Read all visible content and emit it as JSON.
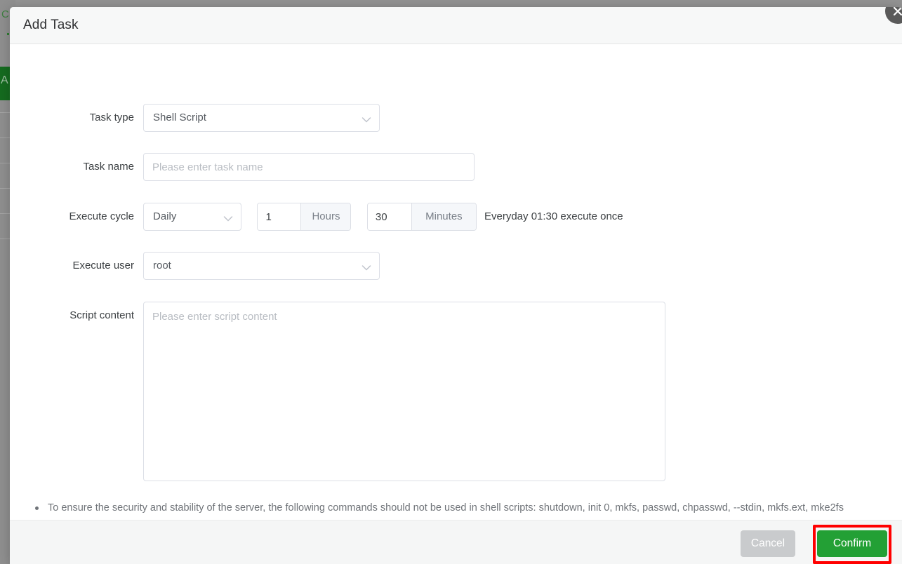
{
  "background": {
    "logo_fragment": "C",
    "sidebar_letter": "A"
  },
  "dialog": {
    "title": "Add Task",
    "close_icon": "close-icon"
  },
  "form": {
    "task_type": {
      "label": "Task type",
      "value": "Shell Script",
      "icon": "chevron-down-icon"
    },
    "task_name": {
      "label": "Task name",
      "value": "",
      "placeholder": "Please enter task name"
    },
    "execute_cycle": {
      "label": "Execute cycle",
      "frequency": "Daily",
      "frequency_icon": "chevron-down-icon",
      "hours_value": "1",
      "hours_unit": "Hours",
      "minutes_value": "30",
      "minutes_unit": "Minutes",
      "summary": "Everyday 01:30 execute once"
    },
    "execute_user": {
      "label": "Execute user",
      "value": "root",
      "icon": "chevron-down-icon"
    },
    "script_content": {
      "label": "Script content",
      "value": "",
      "placeholder": "Please enter script content"
    }
  },
  "hints": [
    "To ensure the security and stability of the server, the following commands should not be used in shell scripts: shutdown, init 0, mkfs, passwd, chpasswd, --stdin, mkfs.ext, mke2fs"
  ],
  "footer": {
    "cancel_label": "Cancel",
    "confirm_label": "Confirm"
  },
  "colors": {
    "confirm_green": "#23a035",
    "highlight_red": "#ff0000",
    "cancel_gray": "#c9cbcd"
  }
}
